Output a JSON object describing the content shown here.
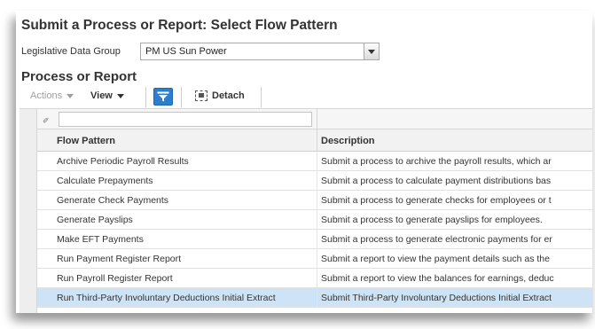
{
  "page": {
    "title": "Submit a Process or Report: Select Flow Pattern"
  },
  "ldg": {
    "label": "Legislative Data Group",
    "value": "PM US Sun Power"
  },
  "section": {
    "title": "Process or Report"
  },
  "toolbar": {
    "actions_label": "Actions",
    "view_label": "View",
    "detach_label": "Detach"
  },
  "table": {
    "columns": [
      "Flow Pattern",
      "Description"
    ],
    "selected_index": 7,
    "rows": [
      {
        "flow_pattern": "Archive Periodic Payroll Results",
        "description": "Submit a process to archive the payroll results, which ar"
      },
      {
        "flow_pattern": "Calculate Prepayments",
        "description": "Submit a process to calculate payment distributions bas"
      },
      {
        "flow_pattern": "Generate Check Payments",
        "description": "Submit a process to generate checks for employees or t"
      },
      {
        "flow_pattern": "Generate Payslips",
        "description": "Submit a process to generate payslips for employees."
      },
      {
        "flow_pattern": "Make EFT Payments",
        "description": "Submit a process to generate electronic payments for er"
      },
      {
        "flow_pattern": "Run Payment Register Report",
        "description": "Submit a report to view the payment details such as the"
      },
      {
        "flow_pattern": "Run Payroll Register Report",
        "description": "Submit a report to view the balances for earnings, deduc"
      },
      {
        "flow_pattern": "Run Third-Party Involuntary Deductions Initial Extract",
        "description": "Submit Third-Party Involuntary Deductions Initial Extract"
      }
    ]
  },
  "colors": {
    "selected_row": "#cfe3f7",
    "filter_button": "#2b7fcd"
  }
}
